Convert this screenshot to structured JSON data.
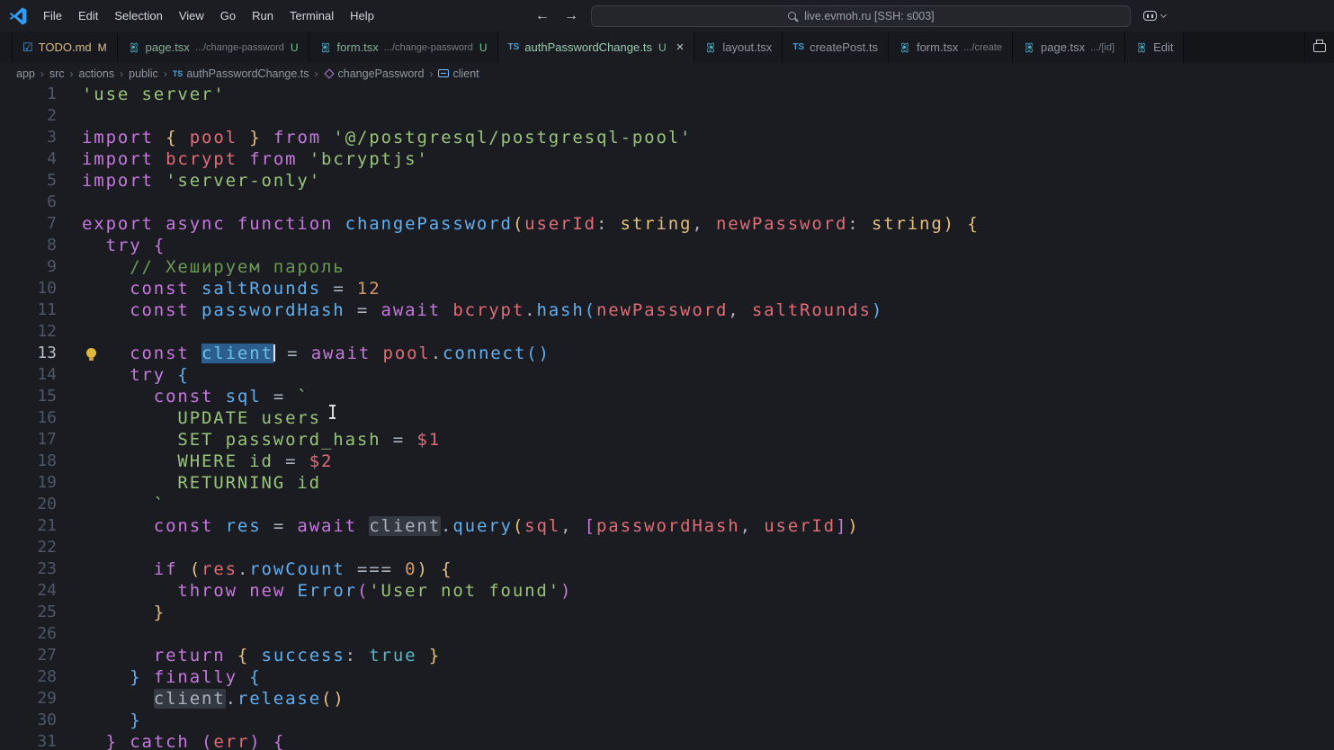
{
  "theme": {
    "editor-bg": "#1a1c22",
    "titlebar-bg": "#1b1d22",
    "tabstrip-bg": "#131519",
    "tab-bg": "#17191e",
    "kw": "#c678dd",
    "fn": "#61afef",
    "vr": "#61afef",
    "rd": "#e06c75",
    "ty": "#e5c07b",
    "nm": "#d19a66",
    "bo": "#56b6c2",
    "st": "#98c379",
    "cm": "#6a9955",
    "pc": "#abb2bf",
    "b1": "#e5c07b",
    "b2": "#c678dd",
    "b3": "#61afef",
    "selection-bg": "#2b5d8e",
    "badge-modified": "#e2c08d",
    "badge-untracked": "#73c991"
  },
  "titlebar": {
    "menus": [
      "File",
      "Edit",
      "Selection",
      "View",
      "Go",
      "Run",
      "Terminal",
      "Help"
    ],
    "back_arrow": "←",
    "forward_arrow": "→",
    "command_center": "live.evmoh.ru [SSH: s003]"
  },
  "tabs": [
    {
      "label": "",
      "fragment": true
    },
    {
      "icon": "todo",
      "label": "TODO.md",
      "status": "mod",
      "badge": "M"
    },
    {
      "icon": "react",
      "label": "page.tsx",
      "status": "untracked",
      "dir": ".../change-password",
      "badge": "U"
    },
    {
      "icon": "react",
      "label": "form.tsx",
      "status": "untracked",
      "dir": ".../change-password",
      "badge": "U"
    },
    {
      "icon": "ts",
      "label": "authPasswordChange.ts",
      "status": "untracked",
      "badge": "U",
      "active": true,
      "close": "×"
    },
    {
      "icon": "react",
      "label": "layout.tsx"
    },
    {
      "icon": "ts",
      "label": "createPost.ts"
    },
    {
      "icon": "react",
      "label": "form.tsx",
      "dir": ".../create"
    },
    {
      "icon": "react",
      "label": "page.tsx",
      "dir": ".../[id]"
    },
    {
      "icon": "react",
      "label": "Edit",
      "fragment": true
    }
  ],
  "breadcrumb": [
    {
      "label": "app"
    },
    {
      "label": "src"
    },
    {
      "label": "actions"
    },
    {
      "label": "public"
    },
    {
      "label": "authPasswordChange.ts",
      "icon": "ts"
    },
    {
      "label": "changePassword",
      "icon": "method"
    },
    {
      "label": "client",
      "icon": "variable"
    }
  ],
  "editor": {
    "cursor_line": 13,
    "lightbulb_line": 13,
    "lines": [
      {
        "n": 1,
        "t": [
          [
            "st",
            "'use server'"
          ]
        ]
      },
      {
        "n": 2,
        "t": []
      },
      {
        "n": 3,
        "t": [
          [
            "kw",
            "import"
          ],
          [
            "pc",
            " "
          ],
          [
            "b1",
            "{"
          ],
          [
            "pc",
            " "
          ],
          [
            "rd",
            "pool"
          ],
          [
            "pc",
            " "
          ],
          [
            "b1",
            "}"
          ],
          [
            "pc",
            " "
          ],
          [
            "kw",
            "from"
          ],
          [
            "pc",
            " "
          ],
          [
            "st",
            "'@/postgresql/postgresql-pool'"
          ]
        ]
      },
      {
        "n": 4,
        "t": [
          [
            "kw",
            "import"
          ],
          [
            "pc",
            " "
          ],
          [
            "rd",
            "bcrypt"
          ],
          [
            "pc",
            " "
          ],
          [
            "kw",
            "from"
          ],
          [
            "pc",
            " "
          ],
          [
            "st",
            "'bcryptjs'"
          ]
        ]
      },
      {
        "n": 5,
        "t": [
          [
            "kw",
            "import"
          ],
          [
            "pc",
            " "
          ],
          [
            "st",
            "'server-only'"
          ]
        ]
      },
      {
        "n": 6,
        "t": []
      },
      {
        "n": 7,
        "t": [
          [
            "kw",
            "export"
          ],
          [
            "pc",
            " "
          ],
          [
            "kw",
            "async"
          ],
          [
            "pc",
            " "
          ],
          [
            "kw",
            "function"
          ],
          [
            "pc",
            " "
          ],
          [
            "fn",
            "changePassword"
          ],
          [
            "b1",
            "("
          ],
          [
            "rd",
            "userId"
          ],
          [
            "pc",
            ": "
          ],
          [
            "ty",
            "string"
          ],
          [
            "pc",
            ", "
          ],
          [
            "rd",
            "newPassword"
          ],
          [
            "pc",
            ": "
          ],
          [
            "ty",
            "string"
          ],
          [
            "b1",
            ")"
          ],
          [
            "pc",
            " "
          ],
          [
            "b1",
            "{"
          ]
        ]
      },
      {
        "n": 8,
        "t": [
          [
            "pc",
            "  "
          ],
          [
            "kw",
            "try"
          ],
          [
            "pc",
            " "
          ],
          [
            "b2",
            "{"
          ]
        ]
      },
      {
        "n": 9,
        "t": [
          [
            "pc",
            "    "
          ],
          [
            "cm",
            "// Хешируем пароль"
          ]
        ]
      },
      {
        "n": 10,
        "t": [
          [
            "pc",
            "    "
          ],
          [
            "kw",
            "const"
          ],
          [
            "pc",
            " "
          ],
          [
            "vr",
            "saltRounds"
          ],
          [
            "pc",
            " = "
          ],
          [
            "nm",
            "12"
          ]
        ]
      },
      {
        "n": 11,
        "t": [
          [
            "pc",
            "    "
          ],
          [
            "kw",
            "const"
          ],
          [
            "pc",
            " "
          ],
          [
            "vr",
            "passwordHash"
          ],
          [
            "pc",
            " = "
          ],
          [
            "kw",
            "await"
          ],
          [
            "pc",
            " "
          ],
          [
            "rd",
            "bcrypt"
          ],
          [
            "pc",
            "."
          ],
          [
            "fn",
            "hash"
          ],
          [
            "b3",
            "("
          ],
          [
            "rd",
            "newPassword"
          ],
          [
            "pc",
            ", "
          ],
          [
            "rd",
            "saltRounds"
          ],
          [
            "b3",
            ")"
          ]
        ]
      },
      {
        "n": 12,
        "t": []
      },
      {
        "n": 13,
        "t": [
          [
            "pc",
            "    "
          ],
          [
            "kw",
            "const"
          ],
          [
            "pc",
            " "
          ],
          [
            "sel",
            "client"
          ],
          [
            "caret",
            ""
          ],
          [
            "pc",
            " = "
          ],
          [
            "kw",
            "await"
          ],
          [
            "pc",
            " "
          ],
          [
            "rd",
            "pool"
          ],
          [
            "pc",
            "."
          ],
          [
            "fn",
            "connect"
          ],
          [
            "b3",
            "("
          ],
          [
            "b3",
            ")"
          ]
        ]
      },
      {
        "n": 14,
        "t": [
          [
            "pc",
            "    "
          ],
          [
            "kw",
            "try"
          ],
          [
            "pc",
            " "
          ],
          [
            "b3",
            "{"
          ]
        ]
      },
      {
        "n": 15,
        "t": [
          [
            "pc",
            "      "
          ],
          [
            "kw",
            "const"
          ],
          [
            "pc",
            " "
          ],
          [
            "vr",
            "sql"
          ],
          [
            "pc",
            " = "
          ],
          [
            "st",
            "`"
          ]
        ]
      },
      {
        "n": 16,
        "t": [
          [
            "st",
            "        UPDATE users"
          ]
        ]
      },
      {
        "n": 17,
        "t": [
          [
            "st",
            "        SET password_hash "
          ],
          [
            "pc",
            "= "
          ],
          [
            "rd",
            "$1"
          ]
        ]
      },
      {
        "n": 18,
        "t": [
          [
            "st",
            "        WHERE id "
          ],
          [
            "pc",
            "= "
          ],
          [
            "rd",
            "$2"
          ]
        ]
      },
      {
        "n": 19,
        "t": [
          [
            "st",
            "        RETURNING id"
          ]
        ]
      },
      {
        "n": 20,
        "t": [
          [
            "st",
            "      `"
          ]
        ]
      },
      {
        "n": 21,
        "t": [
          [
            "pc",
            "      "
          ],
          [
            "kw",
            "const"
          ],
          [
            "pc",
            " "
          ],
          [
            "vr",
            "res"
          ],
          [
            "pc",
            " = "
          ],
          [
            "kw",
            "await"
          ],
          [
            "pc",
            " "
          ],
          [
            "hl",
            "client"
          ],
          [
            "pc",
            "."
          ],
          [
            "fn",
            "query"
          ],
          [
            "b1",
            "("
          ],
          [
            "rd",
            "sql"
          ],
          [
            "pc",
            ", "
          ],
          [
            "b2",
            "["
          ],
          [
            "rd",
            "passwordHash"
          ],
          [
            "pc",
            ", "
          ],
          [
            "rd",
            "userId"
          ],
          [
            "b2",
            "]"
          ],
          [
            "b1",
            ")"
          ]
        ]
      },
      {
        "n": 22,
        "t": []
      },
      {
        "n": 23,
        "t": [
          [
            "pc",
            "      "
          ],
          [
            "kw",
            "if"
          ],
          [
            "pc",
            " "
          ],
          [
            "b1",
            "("
          ],
          [
            "rd",
            "res"
          ],
          [
            "pc",
            "."
          ],
          [
            "vr",
            "rowCount"
          ],
          [
            "pc",
            " === "
          ],
          [
            "nm",
            "0"
          ],
          [
            "b1",
            ")"
          ],
          [
            "pc",
            " "
          ],
          [
            "b1",
            "{"
          ]
        ]
      },
      {
        "n": 24,
        "t": [
          [
            "pc",
            "        "
          ],
          [
            "kw",
            "throw"
          ],
          [
            "pc",
            " "
          ],
          [
            "kw",
            "new"
          ],
          [
            "pc",
            " "
          ],
          [
            "fn",
            "Error"
          ],
          [
            "b2",
            "("
          ],
          [
            "st",
            "'User not found'"
          ],
          [
            "b2",
            ")"
          ]
        ]
      },
      {
        "n": 25,
        "t": [
          [
            "pc",
            "      "
          ],
          [
            "b1",
            "}"
          ]
        ]
      },
      {
        "n": 26,
        "t": []
      },
      {
        "n": 27,
        "t": [
          [
            "pc",
            "      "
          ],
          [
            "kw",
            "return"
          ],
          [
            "pc",
            " "
          ],
          [
            "b1",
            "{"
          ],
          [
            "pc",
            " "
          ],
          [
            "vr",
            "success"
          ],
          [
            "pc",
            ": "
          ],
          [
            "bo",
            "true"
          ],
          [
            "pc",
            " "
          ],
          [
            "b1",
            "}"
          ]
        ]
      },
      {
        "n": 28,
        "t": [
          [
            "pc",
            "    "
          ],
          [
            "b3",
            "}"
          ],
          [
            "pc",
            " "
          ],
          [
            "kw",
            "finally"
          ],
          [
            "pc",
            " "
          ],
          [
            "b3",
            "{"
          ]
        ]
      },
      {
        "n": 29,
        "t": [
          [
            "pc",
            "      "
          ],
          [
            "hl",
            "client"
          ],
          [
            "pc",
            "."
          ],
          [
            "fn",
            "release"
          ],
          [
            "b1",
            "("
          ],
          [
            "b1",
            ")"
          ]
        ]
      },
      {
        "n": 30,
        "t": [
          [
            "pc",
            "    "
          ],
          [
            "b3",
            "}"
          ]
        ]
      },
      {
        "n": 31,
        "t": [
          [
            "pc",
            "  "
          ],
          [
            "b2",
            "}"
          ],
          [
            "pc",
            " "
          ],
          [
            "kw",
            "catch"
          ],
          [
            "pc",
            " "
          ],
          [
            "b2",
            "("
          ],
          [
            "rd",
            "err"
          ],
          [
            "b2",
            ")"
          ],
          [
            "pc",
            " "
          ],
          [
            "b2",
            "{"
          ]
        ]
      }
    ]
  }
}
